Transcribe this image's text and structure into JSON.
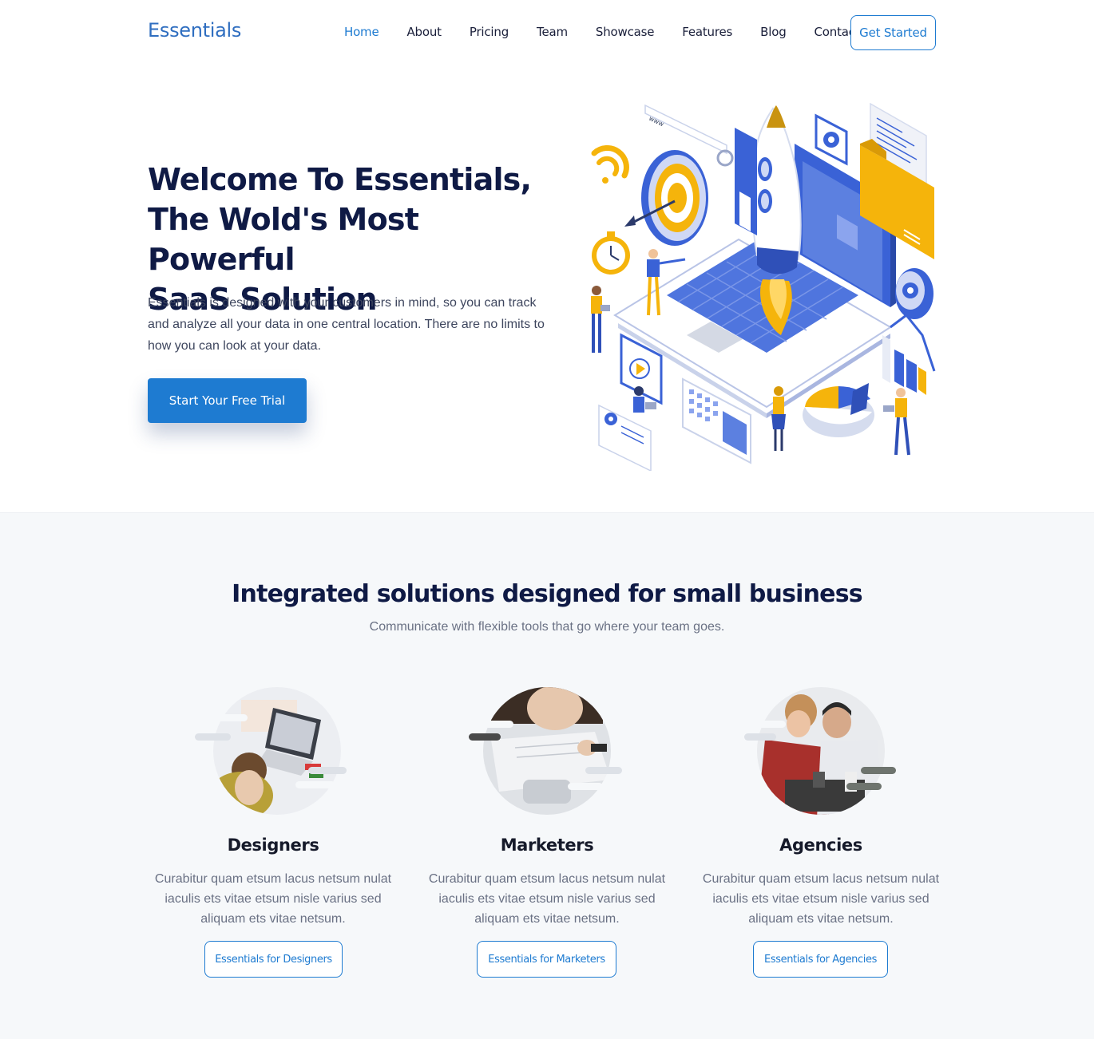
{
  "brand": {
    "logo": "Essentials"
  },
  "nav": {
    "items": [
      {
        "label": "Home",
        "active": true
      },
      {
        "label": "About"
      },
      {
        "label": "Pricing"
      },
      {
        "label": "Team"
      },
      {
        "label": "Showcase"
      },
      {
        "label": "Features"
      },
      {
        "label": "Blog"
      },
      {
        "label": "Contact"
      }
    ],
    "cta": "Get Started"
  },
  "hero": {
    "title_lines": [
      "Welcome To Essentials,",
      "The Wold's Most Powerful",
      "SaaS Solution"
    ],
    "description": "Essentials is designed with your customers in mind, so you can track and analyze all your data in one central location. There are no limits to how you can look at your data.",
    "button": "Start Your Free Trial",
    "illustration_text": "www"
  },
  "solutions": {
    "title": "Integrated solutions designed for small business",
    "subtitle": "Communicate with flexible tools that go where your team goes.",
    "cards": [
      {
        "title": "Designers",
        "description": "Curabitur quam etsum lacus netsum nulat iaculis ets vitae etsum nisle varius sed aliquam ets vitae netsum.",
        "button": "Essentials for Designers"
      },
      {
        "title": "Marketers",
        "description": "Curabitur quam etsum lacus netsum nulat iaculis ets vitae etsum nisle varius sed aliquam ets vitae netsum.",
        "button": "Essentials for Marketers"
      },
      {
        "title": "Agencies",
        "description": "Curabitur quam etsum lacus netsum nulat iaculis ets vitae etsum nisle varius sed aliquam ets vitae netsum.",
        "button": "Essentials for Agencies"
      }
    ]
  },
  "colors": {
    "primary": "#1e7bd1",
    "heading": "#0f1a45",
    "logo": "#2f6ec0",
    "section_bg": "#f6f8fa",
    "illustration_blue": "#3a62d6",
    "illustration_yellow": "#f5b40b"
  }
}
